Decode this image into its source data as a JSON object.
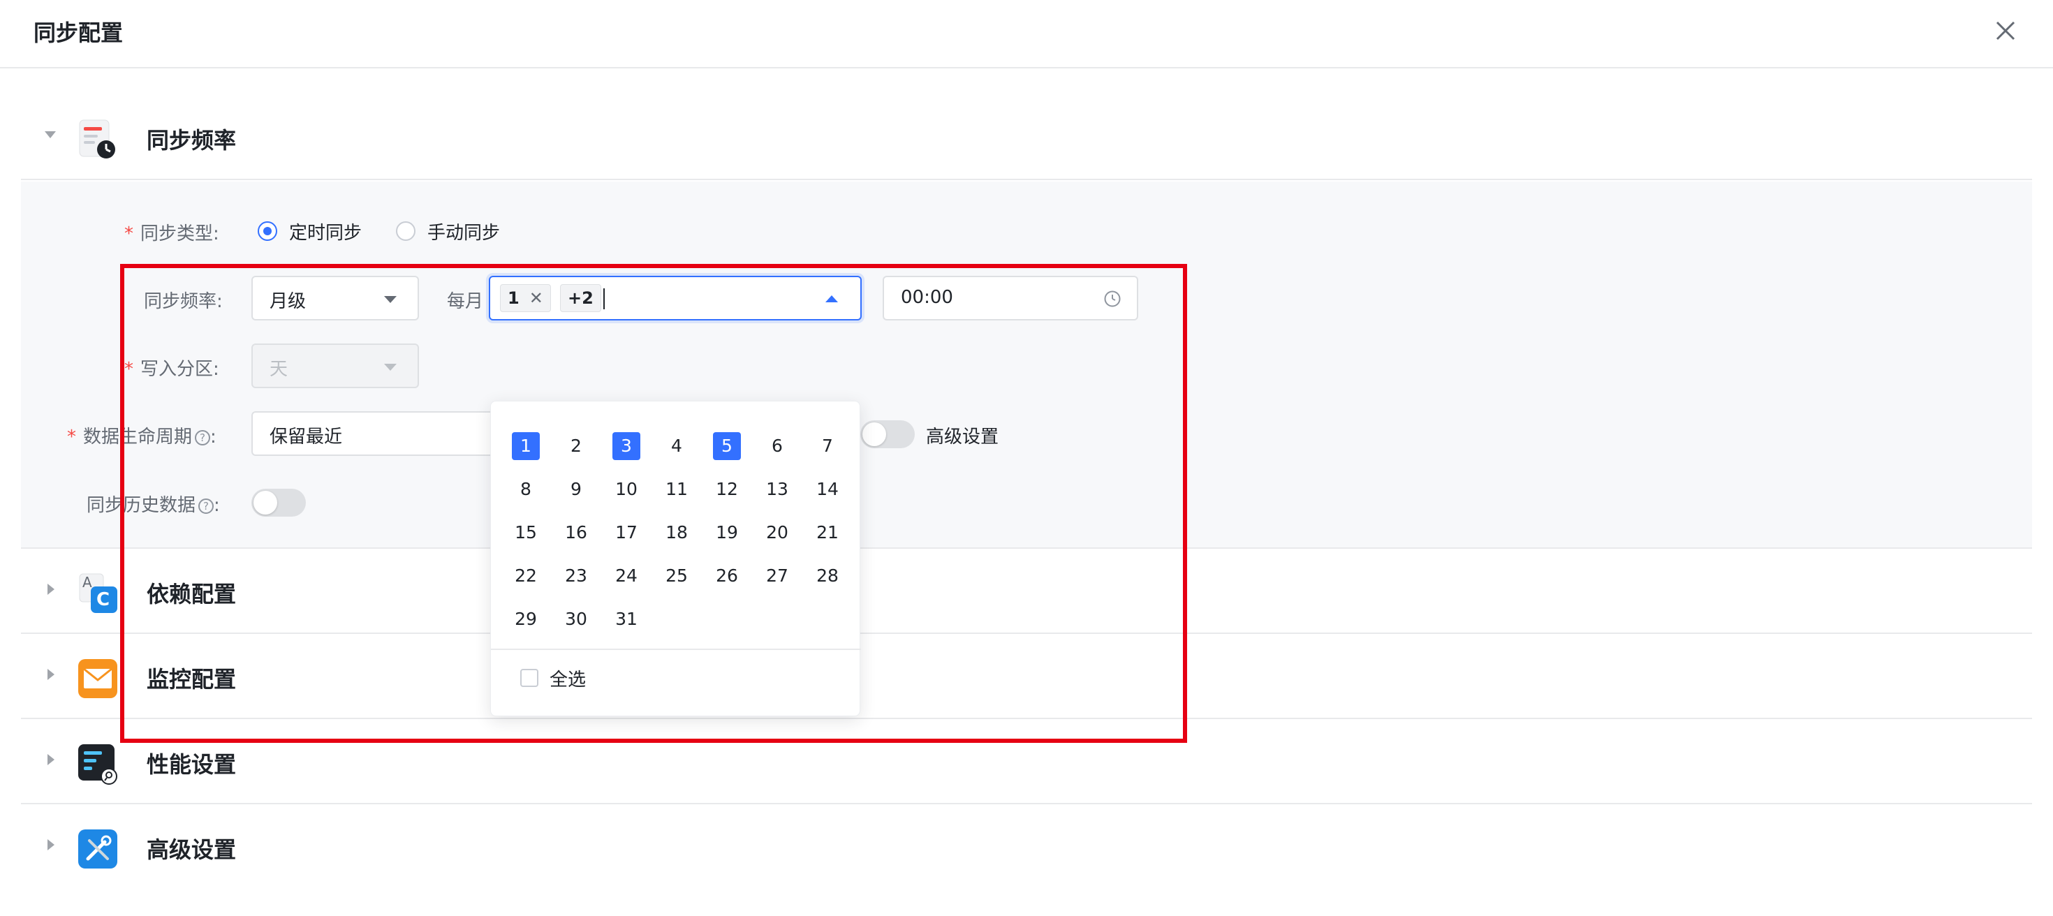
{
  "header": {
    "title": "同步配置"
  },
  "sections": {
    "frequency": {
      "label": "同步频率"
    },
    "dependency": {
      "label": "依赖配置",
      "icon_letters": [
        "A",
        "C"
      ]
    },
    "monitoring": {
      "label": "监控配置"
    },
    "performance": {
      "label": "性能设置"
    },
    "advanced": {
      "label": "高级设置"
    }
  },
  "form": {
    "sync_type_label": "同步类型:",
    "sync_type_options": [
      {
        "label": "定时同步",
        "selected": true
      },
      {
        "label": "手动同步",
        "selected": false
      }
    ],
    "sync_freq_label": "同步频率:",
    "sync_freq_value": "月级",
    "per_month_label": "每月",
    "selected_day_tags": [
      "1",
      "+2"
    ],
    "time_value": "00:00",
    "partition_label": "写入分区:",
    "partition_value": "天",
    "lifecycle_label": "数据生命周期",
    "lifecycle_value": "保留最近",
    "advanced_toggle_label": "高级设置",
    "history_label": "同步历史数据",
    "help_glyph": "?"
  },
  "day_picker": {
    "days": [
      "1",
      "2",
      "3",
      "4",
      "5",
      "6",
      "7",
      "8",
      "9",
      "10",
      "11",
      "12",
      "13",
      "14",
      "15",
      "16",
      "17",
      "18",
      "19",
      "20",
      "21",
      "22",
      "23",
      "24",
      "25",
      "26",
      "27",
      "28",
      "29",
      "30",
      "31"
    ],
    "selected": [
      "1",
      "3",
      "5"
    ],
    "select_all_label": "全选"
  },
  "colors": {
    "accent": "#3370ff",
    "required": "#f54a45",
    "highlight_box": "#e60012"
  },
  "icons": {
    "close": "close-icon",
    "clock": "clock-icon",
    "caret_down": "caret-down-icon",
    "caret_up": "caret-up-icon"
  }
}
